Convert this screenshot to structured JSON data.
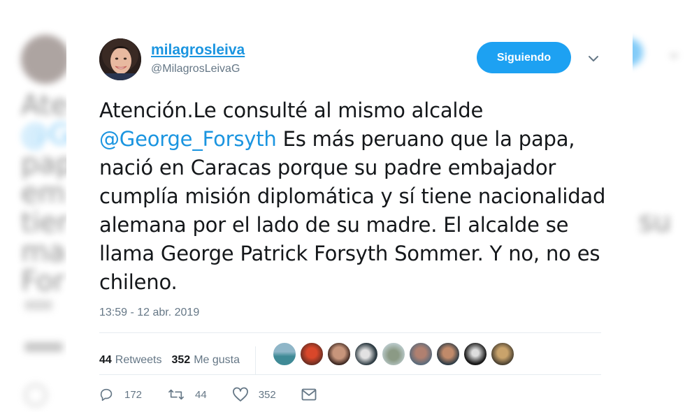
{
  "tweet": {
    "display_name": "milagrosleiva",
    "handle": "@MilagrosLeivaG",
    "follow_label": "Siguiendo",
    "text_before": "Atención.Le consulté al mismo alcalde ",
    "mention": "@George_Forsyth",
    "text_after": " Es más peruano que la papa, nació en Caracas porque su padre embajador cumplía misión diplomática y sí tiene nacionalidad alemana por el lado de su madre. El alcalde se llama George Patrick Forsyth Sommer. Y no, no es chileno.",
    "timestamp": "13:59 - 12 abr. 2019"
  },
  "stats": {
    "retweets_count": "44",
    "retweets_label": "Retweets",
    "likes_count": "352",
    "likes_label": "Me gusta"
  },
  "actions": {
    "replies": "172",
    "retweets": "44",
    "likes": "352"
  },
  "colors": {
    "accent": "#1da1f2",
    "link": "#1b95e0",
    "muted": "#657786",
    "text": "#14171a"
  },
  "icons": [
    "chevron-down-icon",
    "reply-icon",
    "retweet-icon",
    "heart-icon",
    "mail-icon"
  ]
}
